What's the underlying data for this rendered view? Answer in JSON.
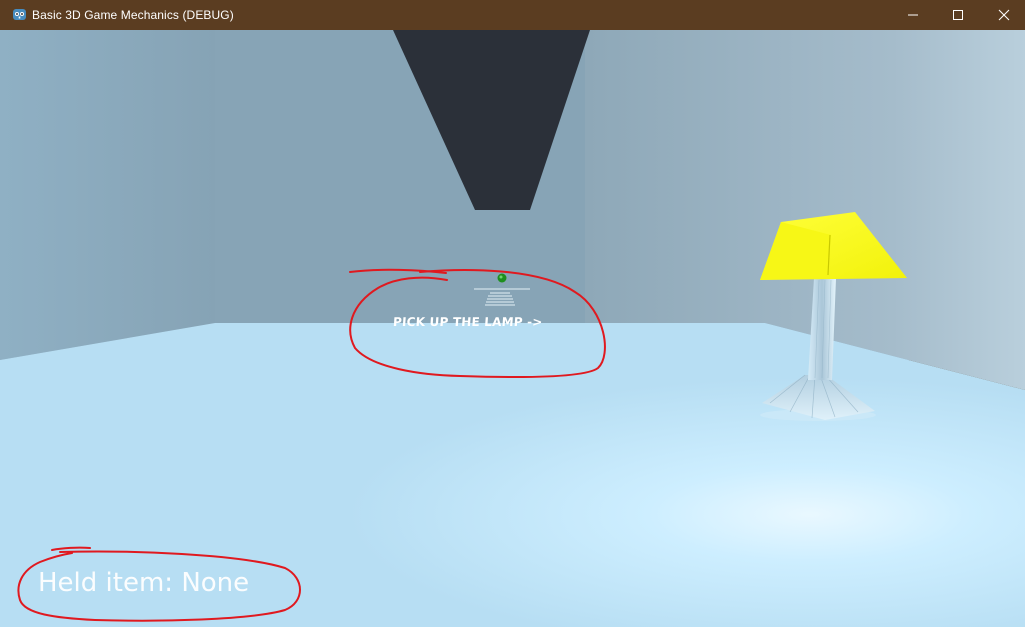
{
  "window": {
    "title": "Basic 3D Game Mechanics (DEBUG)",
    "app_icon": "godot-engine-icon",
    "controls": {
      "minimize_icon": "minimize-icon",
      "maximize_icon": "maximize-icon",
      "close_icon": "close-icon"
    }
  },
  "scene": {
    "colors": {
      "floor": "#bfe4f7",
      "back_wall": "#89a6b7",
      "right_wall": "#9fb6c4",
      "ceiling_beam": "#2b3039",
      "lamp_shade": "#ffff22",
      "crosshair": "#1e8f1e"
    },
    "objects": [
      "lamp",
      "ceiling-beam",
      "crosshair-dot",
      "distant-steps"
    ]
  },
  "hud": {
    "hint_text": "PICK UP THE LAMP ->",
    "held_item_prefix": "Held item:",
    "held_item_value": "None"
  },
  "annotations": {
    "color": "#e0191f",
    "circled": [
      "hint_text",
      "held_item"
    ]
  }
}
